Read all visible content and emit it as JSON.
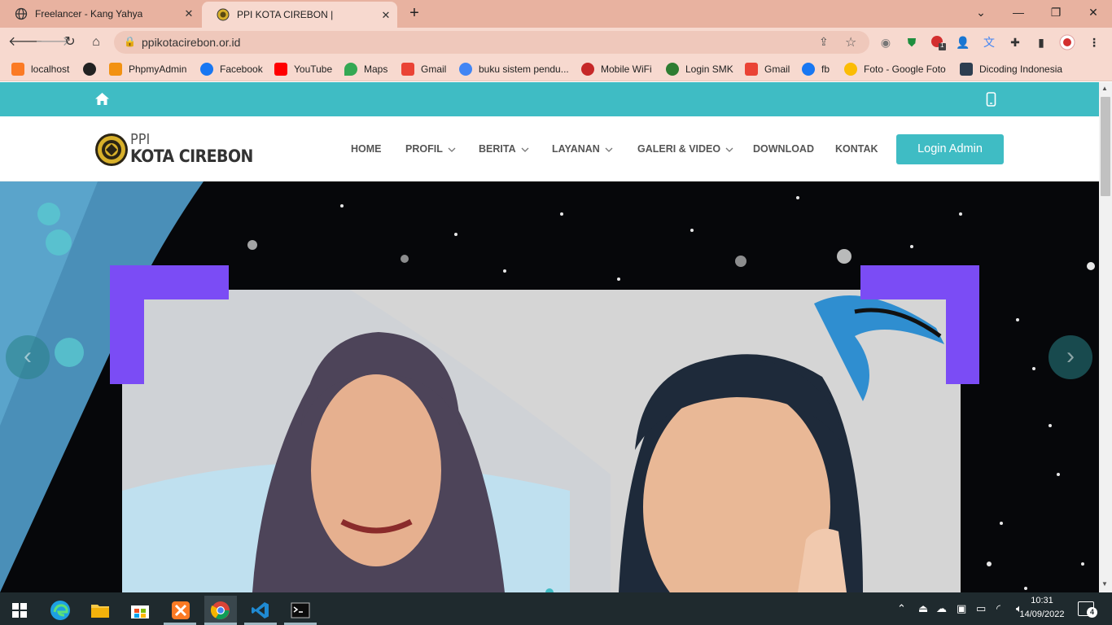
{
  "browser": {
    "tabs": [
      {
        "title": "Freelancer - Kang Yahya"
      },
      {
        "title": "PPI KOTA CIREBON |"
      }
    ],
    "url": "ppikotacirebon.or.id",
    "bookmarks": [
      {
        "label": "localhost",
        "color": "#fb7a24"
      },
      {
        "label": "",
        "color": "#222222"
      },
      {
        "label": "PhpmyAdmin",
        "color": "#f29111"
      },
      {
        "label": "Facebook",
        "color": "#1877f2"
      },
      {
        "label": "YouTube",
        "color": "#ff0000"
      },
      {
        "label": "Maps",
        "color": "#34a853"
      },
      {
        "label": "Gmail",
        "color": "#ea4335"
      },
      {
        "label": "buku sistem pendu...",
        "color": "#4285f4"
      },
      {
        "label": "Mobile WiFi",
        "color": "#c62828"
      },
      {
        "label": "Login SMK",
        "color": "#2e7d32"
      },
      {
        "label": "Gmail",
        "color": "#ea4335"
      },
      {
        "label": "fb",
        "color": "#1877f2"
      },
      {
        "label": "Foto - Google Foto",
        "color": "#fbbc05"
      },
      {
        "label": "Dicoding Indonesia",
        "color": "#2d3e50"
      }
    ],
    "extension_badge": "1"
  },
  "site": {
    "logo_top": "PPI",
    "logo_bottom": "KOTA CIREBON",
    "nav": [
      {
        "label": "HOME",
        "dropdown": false
      },
      {
        "label": "PROFIL",
        "dropdown": true
      },
      {
        "label": "BERITA",
        "dropdown": true
      },
      {
        "label": "LAYANAN",
        "dropdown": true
      },
      {
        "label": "GALERI & VIDEO",
        "dropdown": true
      },
      {
        "label": "DOWNLOAD",
        "dropdown": false
      },
      {
        "label": "KONTAK",
        "dropdown": false
      }
    ],
    "login_label": "Login Admin",
    "accent": "#3fbcc4"
  },
  "taskbar": {
    "time": "10:31",
    "date": "14/09/2022",
    "notifications": "4"
  }
}
